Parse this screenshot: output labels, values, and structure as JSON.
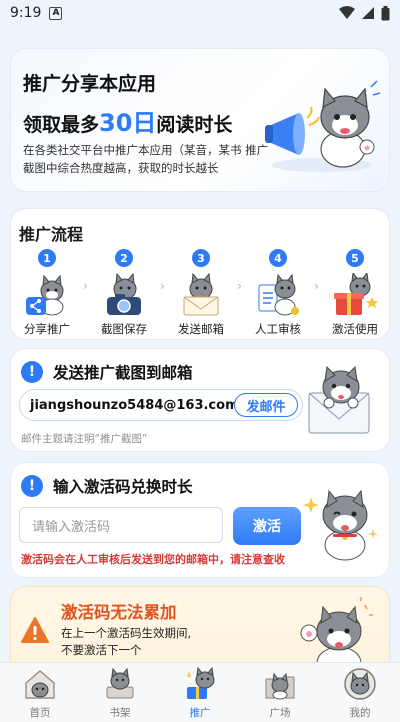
{
  "status_bar": {
    "time": "9:19",
    "badge": "A"
  },
  "hero": {
    "line1": "推广分享本应用",
    "line2_prefix": "领取最多",
    "line2_number": "30日",
    "line2_suffix": "阅读时长",
    "description": "在各类社交平台中推广本应用（某音，某书 推广截图中综合热度越高，获取的时长越长"
  },
  "flow": {
    "title": "推广流程",
    "steps": [
      {
        "num": "1",
        "label": "分享推广"
      },
      {
        "num": "2",
        "label": "截图保存"
      },
      {
        "num": "3",
        "label": "发送邮箱"
      },
      {
        "num": "4",
        "label": "人工审核"
      },
      {
        "num": "5",
        "label": "激活使用"
      }
    ],
    "arrow": "›"
  },
  "send_section": {
    "icon": "!",
    "title": "发送推广截图到邮箱",
    "email": "jiangshounzo5484@163.com",
    "button": "发邮件",
    "hint": "邮件主题请注明“推广截图”"
  },
  "activate_section": {
    "icon": "!",
    "title": "输入激活码兑换时长",
    "placeholder": "请输入激活码",
    "button": "激活",
    "hint": "激活码会在人工审核后发送到您的邮箱中，请注意查收"
  },
  "warning": {
    "title": "激活码无法累加",
    "line1": "在上一个激活码生效期间,",
    "line2": "不要激活下一个"
  },
  "nav": {
    "items": [
      {
        "label": "首页",
        "icon": "home-icon"
      },
      {
        "label": "书架",
        "icon": "bookshelf-icon"
      },
      {
        "label": "推广",
        "icon": "promote-icon"
      },
      {
        "label": "广场",
        "icon": "square-icon"
      },
      {
        "label": "我的",
        "icon": "profile-icon"
      }
    ],
    "active_index": 2
  },
  "colors": {
    "accent": "#2f7bf5",
    "warning": "#e0551f",
    "hint_red": "#d83a3a"
  }
}
